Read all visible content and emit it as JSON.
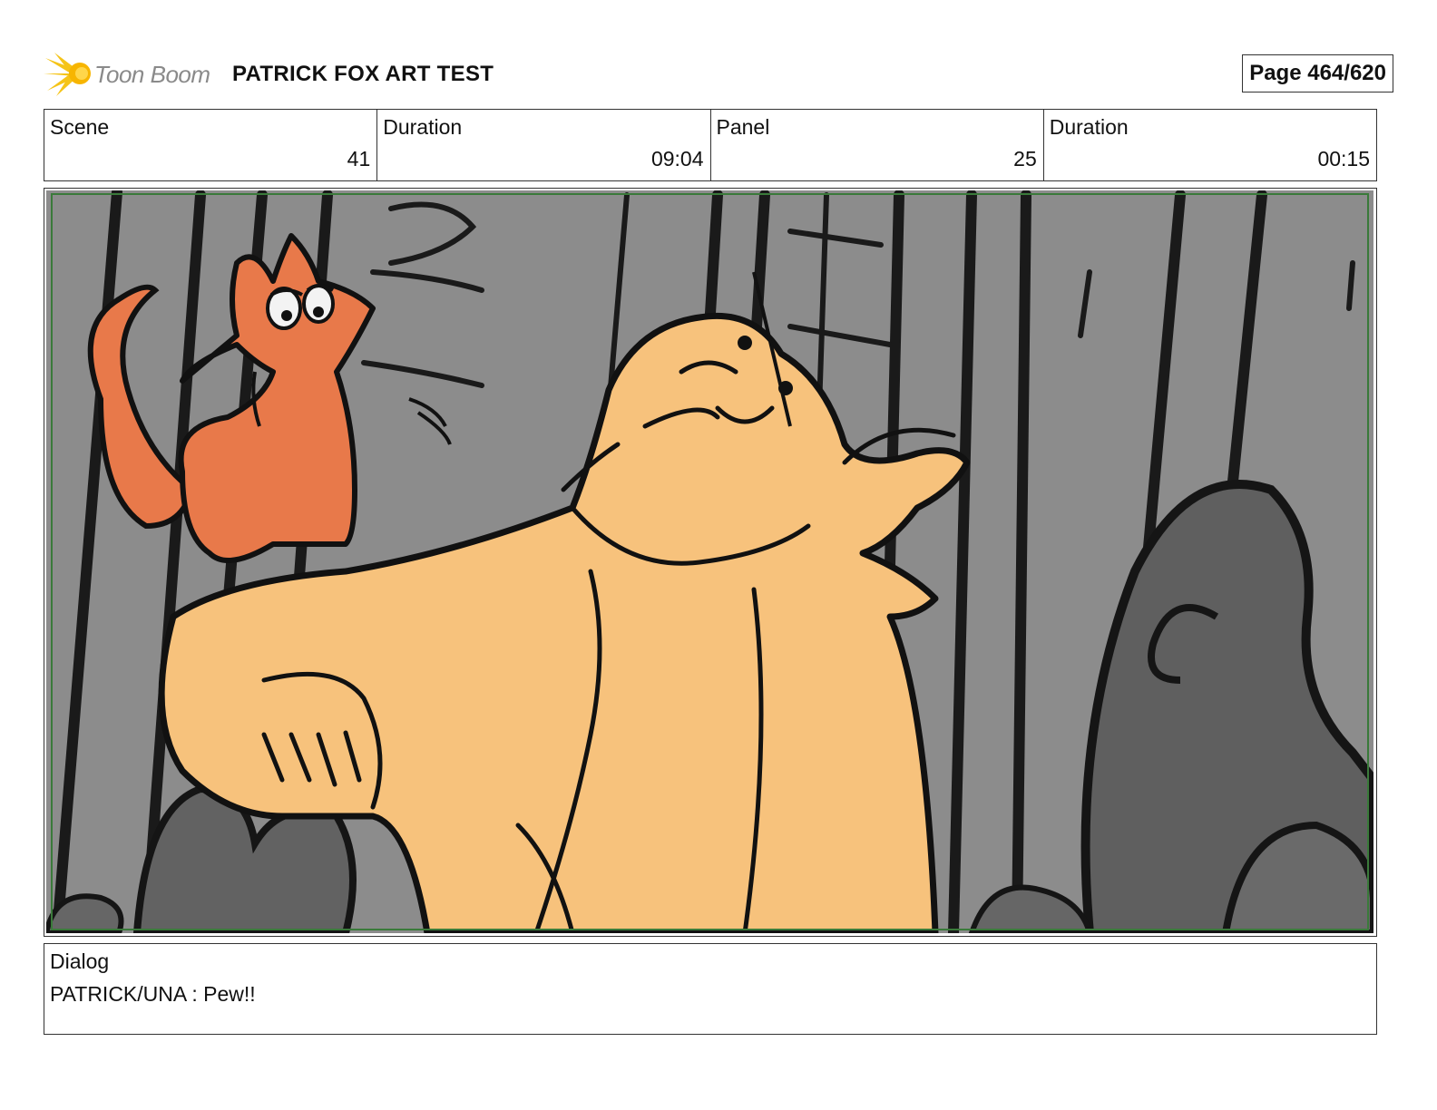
{
  "header": {
    "logo_text": "Toon Boom",
    "project_title": "PATRICK FOX ART TEST",
    "page_indicator": "Page 464/620"
  },
  "info": {
    "scene_label": "Scene",
    "scene_value": "41",
    "scene_duration_label": "Duration",
    "scene_duration_value": "09:04",
    "panel_label": "Panel",
    "panel_value": "25",
    "panel_duration_label": "Duration",
    "panel_duration_value": "00:15"
  },
  "panel_image": {
    "description_icon": "storyboard-drawing",
    "colors": {
      "background_gray": "#8c8c8c",
      "dark_gray": "#5f5f5f",
      "line": "#111111",
      "fox": "#e8794a",
      "character": "#f7c27c",
      "frame_green": "#3a7a3a"
    }
  },
  "dialog": {
    "label": "Dialog",
    "text": "PATRICK/UNA : Pew!!"
  }
}
